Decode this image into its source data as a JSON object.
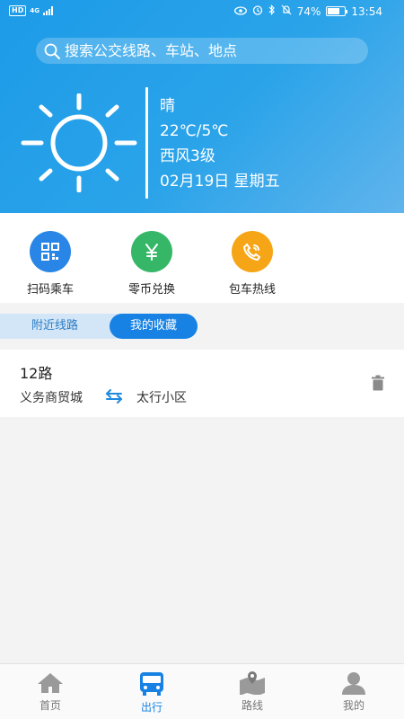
{
  "status_bar": {
    "hd": "HD",
    "network": "4G",
    "battery_text": "74%",
    "battery_level": 0.74,
    "time": "13:54"
  },
  "search": {
    "placeholder": "搜索公交线路、车站、地点"
  },
  "weather": {
    "condition": "晴",
    "temperature": "22℃/5℃",
    "wind": "西风3级",
    "date": "02月19日 星期五"
  },
  "quick_actions": [
    {
      "label": "扫码乘车",
      "icon": "qr-code-icon",
      "color": "#2a86e6"
    },
    {
      "label": "零币兑换",
      "icon": "yuan-icon",
      "color": "#36b768"
    },
    {
      "label": "包车热线",
      "icon": "phone-icon",
      "color": "#f5a515"
    }
  ],
  "tabs": {
    "nearby": "附近线路",
    "favorites": "我的收藏"
  },
  "route": {
    "name": "12路",
    "from": "义务商贸城",
    "to": "太行小区"
  },
  "bottom_nav": [
    {
      "label": "首页",
      "icon": "home-icon"
    },
    {
      "label": "出行",
      "icon": "bus-icon",
      "active": true
    },
    {
      "label": "路线",
      "icon": "map-icon"
    },
    {
      "label": "我的",
      "icon": "profile-icon"
    }
  ],
  "colors": {
    "accent": "#1782e3",
    "hero_start": "#1d9be8",
    "hero_end": "#60b4ec"
  }
}
